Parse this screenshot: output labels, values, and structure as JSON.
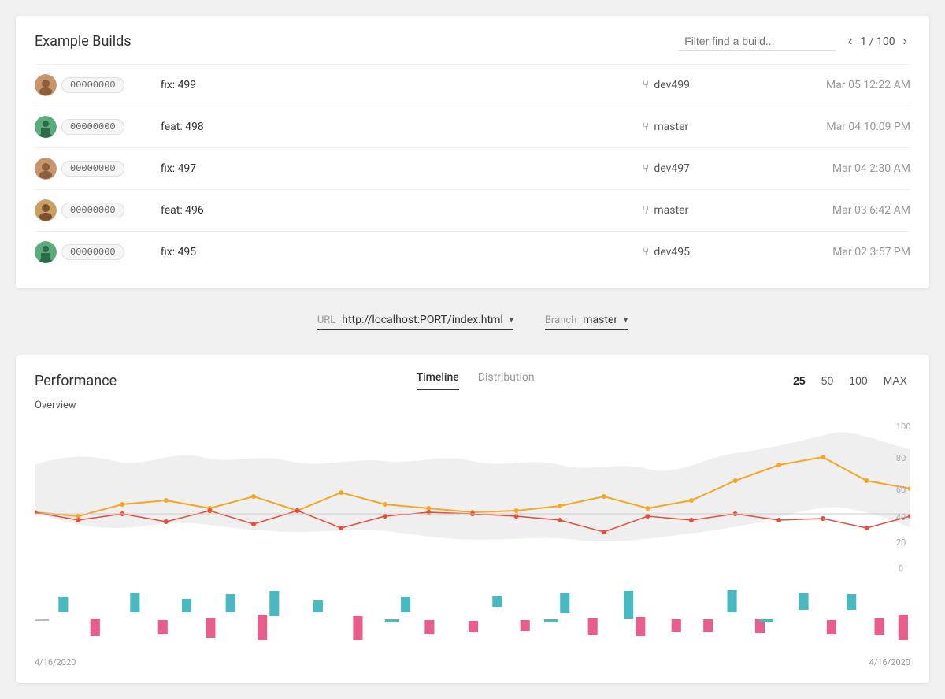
{
  "page": {
    "title": "Example Builds"
  },
  "filter": {
    "placeholder": "Filter find a build..."
  },
  "pagination": {
    "current": "1",
    "total": "100",
    "display": "1 / 100"
  },
  "builds": [
    {
      "id": "00000000",
      "name": "fix: 499",
      "branch": "dev499",
      "date": "Mar 05 12:22 AM",
      "avatarClass": "avatar-1"
    },
    {
      "id": "00000000",
      "name": "feat: 498",
      "branch": "master",
      "date": "Mar 04 10:09 PM",
      "avatarClass": "avatar-2"
    },
    {
      "id": "00000000",
      "name": "fix: 497",
      "branch": "dev497",
      "date": "Mar 04 2:30 AM",
      "avatarClass": "avatar-3"
    },
    {
      "id": "00000000",
      "name": "feat: 496",
      "branch": "master",
      "date": "Mar 03 6:42 AM",
      "avatarClass": "avatar-4"
    },
    {
      "id": "00000000",
      "name": "fix: 495",
      "branch": "dev495",
      "date": "Mar 02 3:57 PM",
      "avatarClass": "avatar-5"
    }
  ],
  "urlBar": {
    "label": "URL",
    "value": "http://localhost:PORT/index.html"
  },
  "branchBar": {
    "label": "Branch",
    "value": "master"
  },
  "performance": {
    "title": "Performance",
    "tabs": [
      "Timeline",
      "Distribution"
    ],
    "activeTab": "Timeline",
    "countOptions": [
      "25",
      "50",
      "100",
      "MAX"
    ],
    "activeCount": "25",
    "overviewLabel": "Overview",
    "yAxisLabels": [
      "100",
      "80",
      "60",
      "40",
      "20",
      "0"
    ],
    "dateStart": "4/16/2020",
    "dateEnd": "4/16/2020"
  }
}
